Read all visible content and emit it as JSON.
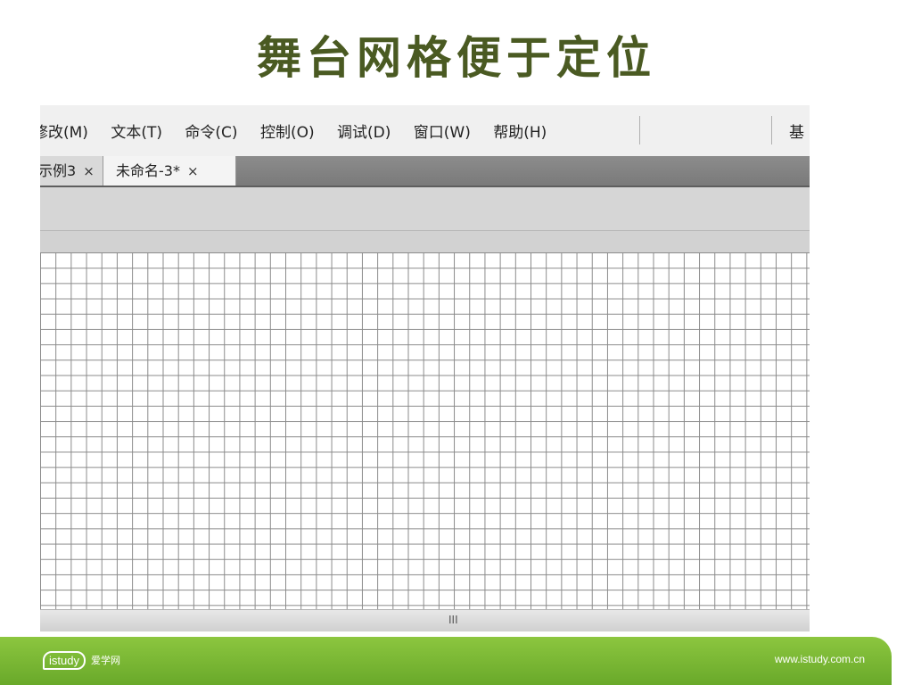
{
  "slide": {
    "title": "舞台网格便于定位"
  },
  "menubar": {
    "items": [
      "修改(M)",
      "文本(T)",
      "命令(C)",
      "控制(O)",
      "调试(D)",
      "窗口(W)",
      "帮助(H)"
    ],
    "right_label": "基"
  },
  "tabs": [
    {
      "label": "示例3",
      "close": "×",
      "active": false
    },
    {
      "label": "未命名-3*",
      "close": "×",
      "active": true
    }
  ],
  "scrollbar": {
    "grip": "III"
  },
  "footer": {
    "logo_brand": "istudy",
    "logo_cn": "爱学网",
    "url": "www.istudy.com.cn"
  },
  "colors": {
    "title": "#4a5a22",
    "footer_green": "#7db83a",
    "grid_line": "#8a8a8a"
  }
}
